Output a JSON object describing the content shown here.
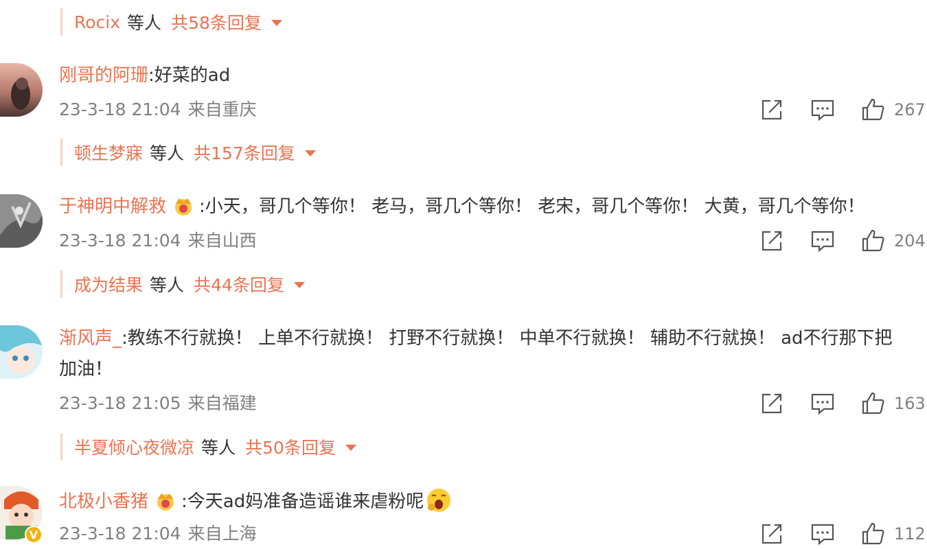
{
  "colors": {
    "accent": "#eb7350",
    "meta": "#808080",
    "text": "#333333"
  },
  "threads": [
    {
      "reply_bar": {
        "names": "Rocix",
        "suffix": "等人",
        "count": "共58条回复"
      }
    },
    {
      "user": "刚哥的阿珊",
      "text": ":好菜的ad",
      "date": "23-3-18 21:04",
      "location": "来自重庆",
      "likes": "267",
      "reply_bar": {
        "names": "顿生梦寐",
        "suffix": "等人",
        "count": "共157条回复"
      }
    },
    {
      "user": "于神明中解救",
      "vip_icon": "vip-crown-icon",
      "text": ":小天，哥几个等你！ 老马，哥几个等你！ 老宋，哥几个等你！ 大黄，哥几个等你！",
      "date": "23-3-18 21:04",
      "location": "来自山西",
      "likes": "204",
      "reply_bar": {
        "names": "成为结果",
        "suffix": "等人",
        "count": "共44条回复"
      }
    },
    {
      "user": "渐风声_",
      "text": ":教练不行就换！ 上单不行就换！ 打野不行就换！ 中单不行就换！ 辅助不行就换！ ad不行那下把",
      "text_line2": "加油！",
      "date": "23-3-18 21:05",
      "location": "来自福建",
      "likes": "163",
      "reply_bar": {
        "names": "半夏倾心夜微凉",
        "suffix": "等人",
        "count": "共50条回复"
      }
    },
    {
      "user": "北极小香猪",
      "vip_icon": "vip-crown-icon",
      "text": ":今天ad妈准备造谣谁来虐粉呢",
      "emoji": "yawn-emoji-icon",
      "date": "23-3-18 21:04",
      "location": "来自上海",
      "likes": "112",
      "verified_badge": "V"
    }
  ]
}
